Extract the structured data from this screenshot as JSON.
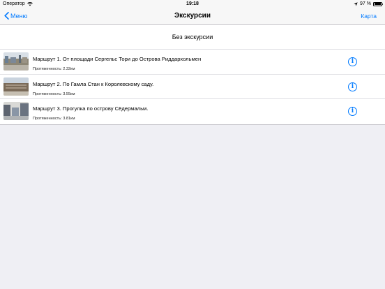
{
  "status": {
    "carrier": "Оператор",
    "time": "19:18",
    "battery": "97 %",
    "battery_level": 0.97
  },
  "nav": {
    "back_label": "Меню",
    "title": "Экскурсии",
    "right_label": "Карта"
  },
  "no_tour_label": "Без экскурсии",
  "routes": [
    {
      "title": "Маршрут 1.  От площади Сергельс Тори до Острова Риддархольмен",
      "length": "Протяженность: 2.32км",
      "thumb_colors": [
        "#6b7f93",
        "#8c8676",
        "#d8dfe6"
      ]
    },
    {
      "title": "Маршрут 2. По Гамла Стан к Королевскому саду.",
      "length": "Протяженность: 3.55км",
      "thumb_colors": [
        "#9aa8b8",
        "#7a6a58",
        "#c6bfb2"
      ]
    },
    {
      "title": "Маршрут 3. Прогулка по острову Сёдермальм.",
      "length": "Протяженность: 3.81км",
      "thumb_colors": [
        "#8a96a6",
        "#5d6470",
        "#d9d9d6"
      ]
    }
  ]
}
